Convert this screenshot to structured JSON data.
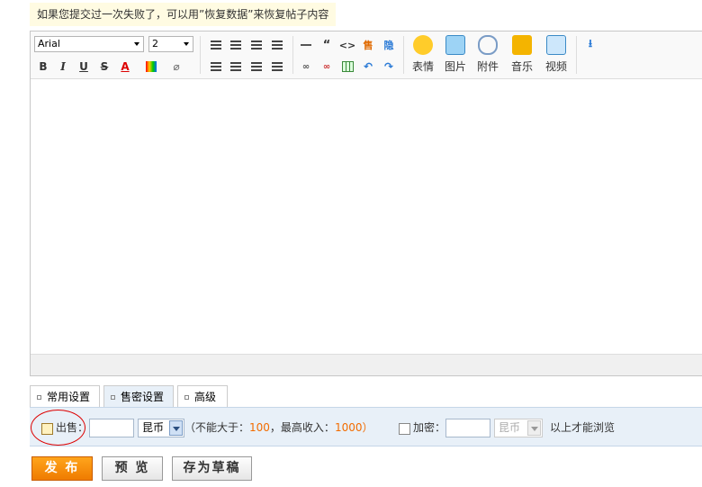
{
  "notice": "如果您提交过一次失败了，可以用”恢复数据”来恢复帖子内容",
  "toolbar": {
    "font_family": "Arial",
    "font_size": "2",
    "buttons": [
      "表情",
      "图片",
      "附件",
      "音乐",
      "视频"
    ]
  },
  "tabs": [
    "常用设置",
    "售密设置",
    "高级"
  ],
  "settings": {
    "sell_label": "出售：",
    "currency": "昆币",
    "hint_prefix": "（不能大于：",
    "max_price": "100",
    "hint_middle": "，最高收入：",
    "max_income": "1000",
    "hint_suffix": "）",
    "encrypt_label": "加密：",
    "currency2": "昆币",
    "encrypt_hint": "以上才能浏览"
  },
  "actions": {
    "publish": "发 布",
    "preview": "预 览",
    "save_draft": "存为草稿"
  },
  "colors": {
    "accent": "#f26c00",
    "panel": "#e8f0f8",
    "notice_bg": "#fffbe2"
  }
}
